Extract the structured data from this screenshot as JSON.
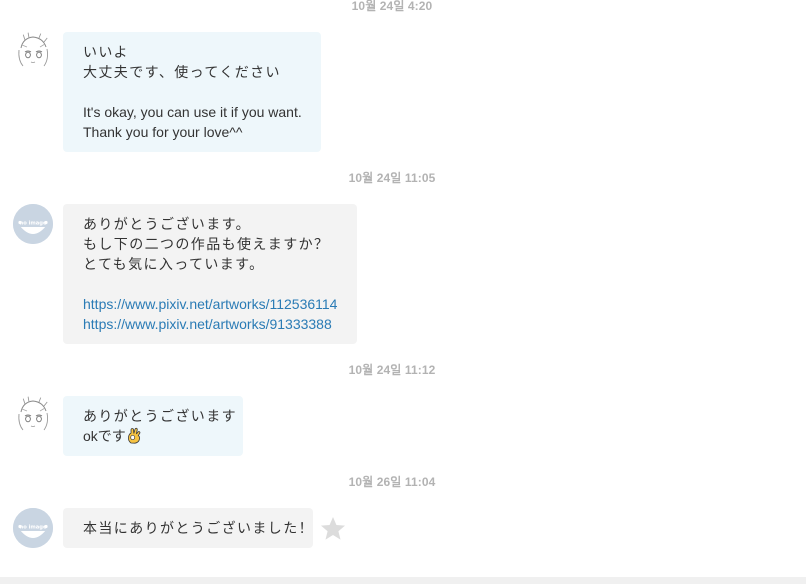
{
  "messages": [
    {
      "timestamp": "10월 24일 4:20",
      "sender": "me",
      "avatar_icon": "sketch-character-avatar",
      "lines": [
        "いいよ",
        "大丈夫です、使ってください",
        "",
        "It's okay, you can use it if you want.",
        "Thank you for your love^^"
      ]
    },
    {
      "timestamp": "10월 24일 11:05",
      "sender": "them",
      "avatar_icon": "default-user-avatar",
      "lines": [
        "ありがとうございます。",
        "もし下の二つの作品も使えますか？",
        "とても気に入っています。",
        ""
      ],
      "links": [
        "https://www.pixiv.net/artworks/112536114",
        "https://www.pixiv.net/artworks/91333388"
      ]
    },
    {
      "timestamp": "10월 24일 11:12",
      "sender": "me",
      "avatar_icon": "sketch-character-avatar",
      "lines": [
        "ありがとうございます",
        "okです"
      ],
      "emoji": "ok-hand-emoji"
    },
    {
      "timestamp": "10월 26일 11:04",
      "sender": "them",
      "avatar_icon": "default-user-avatar",
      "lines": [
        "本当にありがとうございました！"
      ],
      "action_icon": "star-icon"
    }
  ],
  "colors": {
    "mine_bubble": "#eef7fb",
    "theirs_bubble": "#f3f3f3",
    "link": "#2a7bb5",
    "timestamp": "#b3b3b3",
    "default_avatar": "#c9d5e2"
  }
}
